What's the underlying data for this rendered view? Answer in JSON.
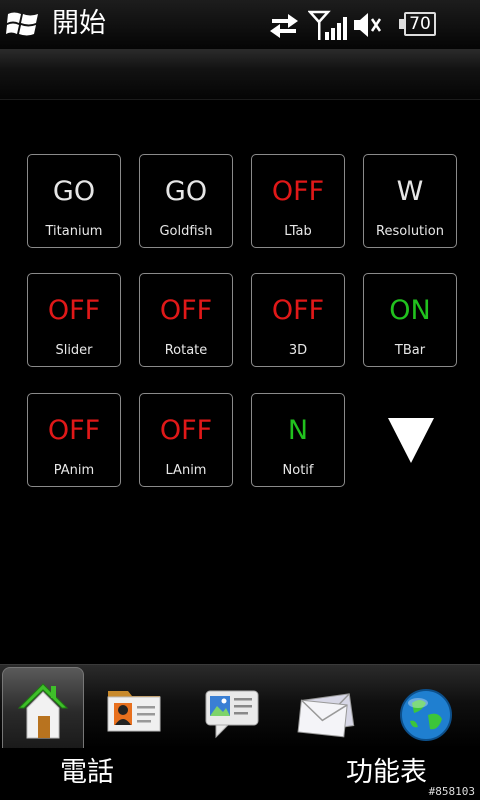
{
  "status_bar": {
    "start_label": "開始",
    "battery_level": "70",
    "icons": [
      "windows-logo-icon",
      "data-sync-arrows-icon",
      "signal-strength-icon",
      "speaker-muted-icon",
      "battery-icon"
    ]
  },
  "tiles": [
    {
      "state": "GO",
      "label": "Titanium",
      "color": "#e6e6e6"
    },
    {
      "state": "GO",
      "label": "Goldfish",
      "color": "#e6e6e6"
    },
    {
      "state": "OFF",
      "label": "LTab",
      "color": "#e01818"
    },
    {
      "state": "W",
      "label": "Resolution",
      "color": "#e6e6e6"
    },
    {
      "state": "OFF",
      "label": "Slider",
      "color": "#e01818"
    },
    {
      "state": "OFF",
      "label": "Rotate",
      "color": "#e01818"
    },
    {
      "state": "OFF",
      "label": "3D",
      "color": "#e01818"
    },
    {
      "state": "ON",
      "label": "TBar",
      "color": "#21c21e"
    },
    {
      "state": "OFF",
      "label": "PAnim",
      "color": "#e01818"
    },
    {
      "state": "OFF",
      "label": "LAnim",
      "color": "#e01818"
    },
    {
      "state": "N",
      "label": "Notif",
      "color": "#21c21e"
    }
  ],
  "dock": {
    "tabs": [
      "home-icon",
      "contact-card-icon",
      "messaging-icon",
      "mail-icon",
      "internet-globe-icon"
    ],
    "active": "home-icon"
  },
  "soft_keys": {
    "left": "電話",
    "right": "功能表"
  },
  "watermark": "#858103"
}
